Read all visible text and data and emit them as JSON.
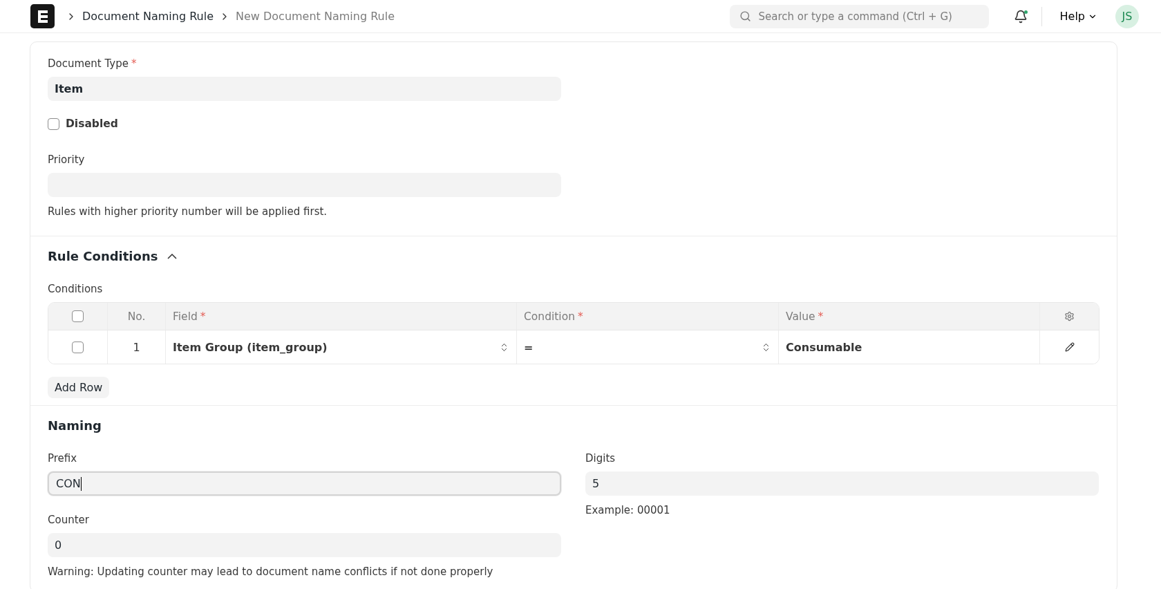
{
  "navbar": {
    "breadcrumbs": [
      {
        "label": "Document Naming Rule",
        "current": false
      },
      {
        "label": "New Document Naming Rule",
        "current": true
      }
    ],
    "search": {
      "placeholder": "Search or type a command (Ctrl + G)"
    },
    "notifications": {
      "unread": true
    },
    "help": "Help",
    "avatar": "JS"
  },
  "form": {
    "document_type": {
      "label": "Document Type",
      "mark": "*",
      "value": "Item"
    },
    "disabled": {
      "label": "Disabled",
      "checked": false
    },
    "priority": {
      "label": "Priority",
      "description": "Rules with higher priority number will be applied first."
    },
    "rule_conditions": {
      "title": "Rule Conditions",
      "expanded": true,
      "table_label": "Conditions",
      "table": {
        "select_all": {
          "checked": false
        },
        "columns": [
          {
            "label": "No."
          },
          {
            "label": "Field",
            "mark": "*"
          },
          {
            "label": "Condition",
            "mark": "*"
          },
          {
            "label": "Value",
            "mark": "*"
          }
        ],
        "rows": [
          {
            "checked": false,
            "no": "1",
            "field": "Item Group (item_group)",
            "condition": "=",
            "value": "Consumable"
          }
        ]
      },
      "add_row": "Add Row"
    },
    "naming": {
      "title": "Naming",
      "prefix": {
        "label": "Prefix",
        "value": "CON",
        "focused": true
      },
      "digits": {
        "label": "Digits",
        "value": "5",
        "description": "Example: 00001"
      },
      "counter": {
        "label": "Counter",
        "value": "0",
        "description": "Warning: Updating counter may lead to document name conflicts if not done properly"
      }
    }
  }
}
